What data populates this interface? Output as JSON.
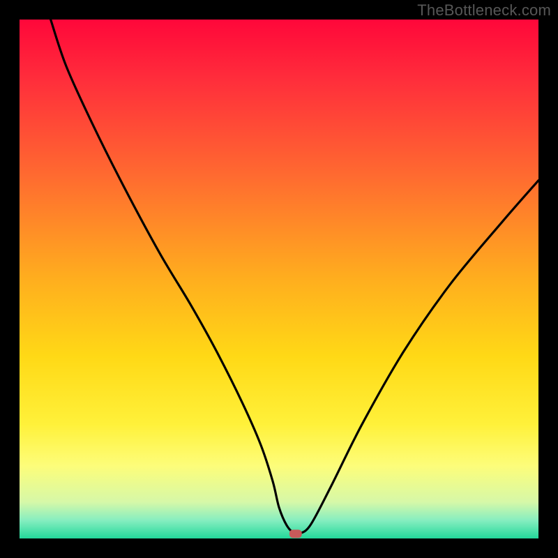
{
  "watermark": "TheBottleneck.com",
  "chart_data": {
    "type": "line",
    "title": "",
    "xlabel": "",
    "ylabel": "",
    "xlim": [
      0,
      100
    ],
    "ylim": [
      0,
      100
    ],
    "grid": false,
    "legend": false,
    "background": {
      "type": "vertical-gradient",
      "stops": [
        {
          "pos": 0.0,
          "color": "#ff073a"
        },
        {
          "pos": 0.12,
          "color": "#ff2f3b"
        },
        {
          "pos": 0.3,
          "color": "#ff6a30"
        },
        {
          "pos": 0.5,
          "color": "#ffae1e"
        },
        {
          "pos": 0.65,
          "color": "#ffd916"
        },
        {
          "pos": 0.78,
          "color": "#fff13a"
        },
        {
          "pos": 0.86,
          "color": "#fdfd7a"
        },
        {
          "pos": 0.93,
          "color": "#d6f8a8"
        },
        {
          "pos": 0.965,
          "color": "#86eec0"
        },
        {
          "pos": 1.0,
          "color": "#23d89a"
        }
      ]
    },
    "series": [
      {
        "name": "bottleneck-curve",
        "color": "#000000",
        "x": [
          6,
          9,
          14,
          20,
          27,
          33,
          38,
          43,
          46.5,
          48.8,
          50.0,
          51.5,
          53.0,
          53.8,
          56.0,
          60.0,
          66.0,
          74.0,
          83.0,
          93.0,
          100.0
        ],
        "y": [
          100,
          91,
          80,
          68,
          55,
          45,
          36,
          26,
          18.0,
          11.0,
          6.0,
          2.5,
          0.9,
          0.9,
          2.5,
          10.0,
          22.0,
          36.0,
          49.0,
          61.0,
          69.0
        ]
      }
    ],
    "marker": {
      "name": "selected-point",
      "x": 53.2,
      "y": 0.9,
      "color": "#c75a5a",
      "shape": "rounded-rect",
      "width_pct": 2.4,
      "height_pct": 1.6
    }
  }
}
